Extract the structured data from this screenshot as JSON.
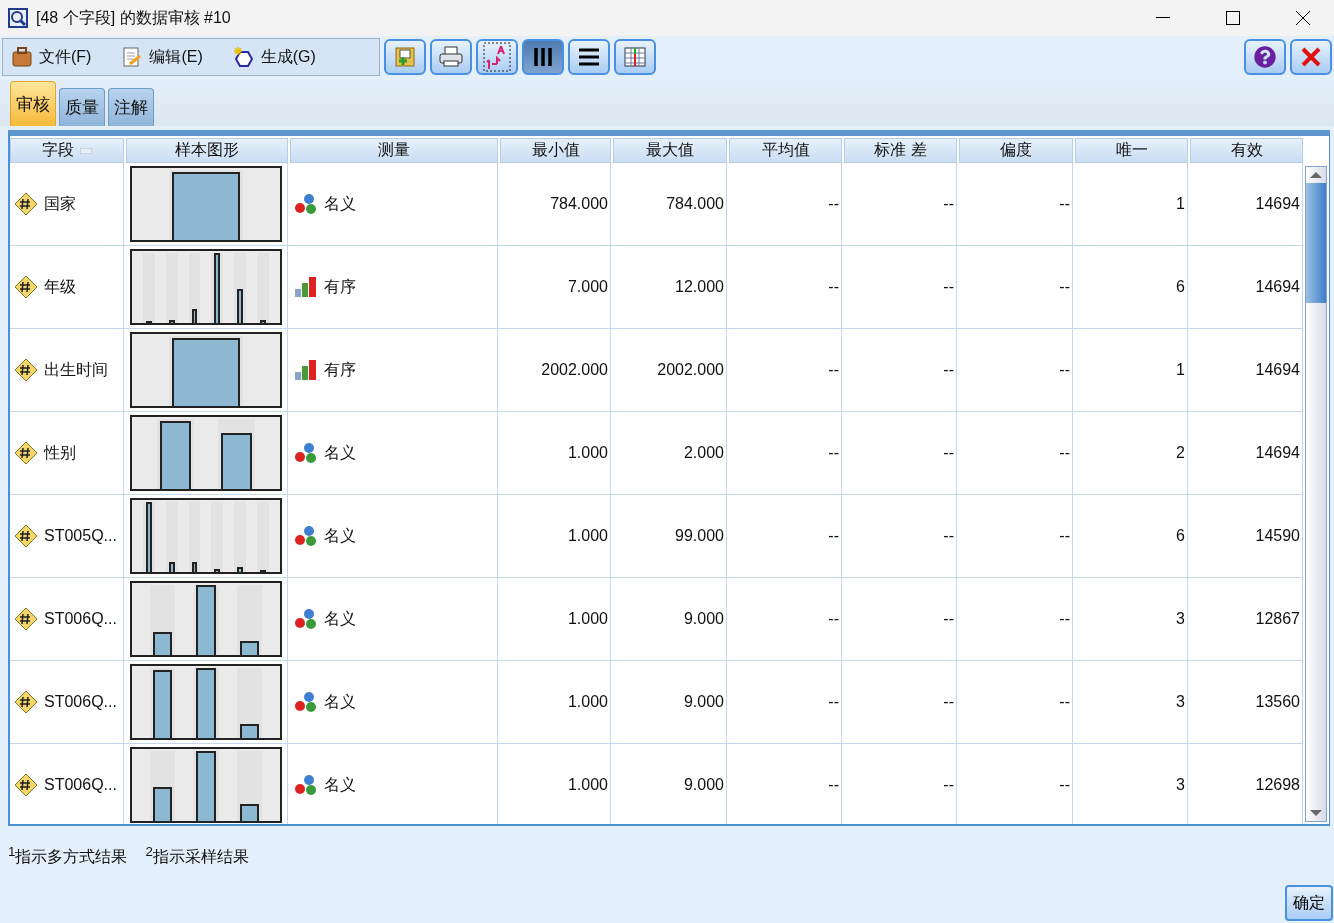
{
  "window": {
    "title": "[48 个字段] 的数据审核 #10"
  },
  "menu": [
    "文件(F)",
    "编辑(E)",
    "生成(G)"
  ],
  "toolbar": [
    {
      "kind": "add",
      "pressed": false
    },
    {
      "kind": "print",
      "pressed": false
    },
    {
      "kind": "sort",
      "pressed": false
    },
    {
      "kind": "columns",
      "pressed": true
    },
    {
      "kind": "rows",
      "pressed": false
    },
    {
      "kind": "table",
      "pressed": false
    }
  ],
  "tabs": [
    {
      "label": "审核",
      "selected": true
    },
    {
      "label": "质量",
      "selected": false
    },
    {
      "label": "注解",
      "selected": false
    }
  ],
  "table": {
    "columns": [
      "字段",
      "样本图形",
      "测量",
      "最小值",
      "最大值",
      "平均值",
      "标准 差",
      "偏度",
      "唯一",
      "有效"
    ],
    "rows": [
      {
        "field": "国家",
        "graph": [
          {
            "level": 0.97
          }
        ],
        "measure": {
          "kind": "nominal",
          "label": "名义"
        },
        "min": "784.000",
        "max": "784.000",
        "mean": "--",
        "sd": "--",
        "skew": "--",
        "unique": "1",
        "valid": "14694"
      },
      {
        "field": "年级",
        "graph": [
          {
            "level": 0.03
          },
          {
            "level": 0.04
          },
          {
            "level": 0.2
          },
          {
            "level": 1.0
          },
          {
            "level": 0.48
          },
          {
            "level": 0.04
          }
        ],
        "measure": {
          "kind": "ordinal",
          "label": "有序"
        },
        "min": "7.000",
        "max": "12.000",
        "mean": "--",
        "sd": "--",
        "skew": "--",
        "unique": "6",
        "valid": "14694"
      },
      {
        "field": "出生时间",
        "graph": [
          {
            "level": 0.97
          }
        ],
        "measure": {
          "kind": "ordinal",
          "label": "有序"
        },
        "min": "2002.000",
        "max": "2002.000",
        "mean": "--",
        "sd": "--",
        "skew": "--",
        "unique": "1",
        "valid": "14694"
      },
      {
        "field": "性别",
        "graph": [
          {
            "level": 0.97
          },
          {
            "level": 0.8
          }
        ],
        "measure": {
          "kind": "nominal",
          "label": "名义"
        },
        "min": "1.000",
        "max": "2.000",
        "mean": "--",
        "sd": "--",
        "skew": "--",
        "unique": "2",
        "valid": "14694"
      },
      {
        "field": "ST005Q...",
        "graph": [
          {
            "level": 1.0
          },
          {
            "level": 0.14
          },
          {
            "level": 0.14
          },
          {
            "level": 0.05
          },
          {
            "level": 0.07
          },
          {
            "level": 0.03
          }
        ],
        "measure": {
          "kind": "nominal",
          "label": "名义"
        },
        "min": "1.000",
        "max": "99.000",
        "mean": "--",
        "sd": "--",
        "skew": "--",
        "unique": "6",
        "valid": "14590"
      },
      {
        "field": "ST006Q...",
        "graph": [
          {
            "level": 0.33
          },
          {
            "level": 1.0
          },
          {
            "level": 0.2
          }
        ],
        "measure": {
          "kind": "nominal",
          "label": "名义"
        },
        "min": "1.000",
        "max": "9.000",
        "mean": "--",
        "sd": "--",
        "skew": "--",
        "unique": "3",
        "valid": "12867"
      },
      {
        "field": "ST006Q...",
        "graph": [
          {
            "level": 0.97
          },
          {
            "level": 1.0
          },
          {
            "level": 0.2
          }
        ],
        "measure": {
          "kind": "nominal",
          "label": "名义"
        },
        "min": "1.000",
        "max": "9.000",
        "mean": "--",
        "sd": "--",
        "skew": "--",
        "unique": "3",
        "valid": "13560"
      },
      {
        "field": "ST006Q...",
        "graph": [
          {
            "level": 0.48
          },
          {
            "level": 1.0
          },
          {
            "level": 0.25
          }
        ],
        "measure": {
          "kind": "nominal",
          "label": "名义"
        },
        "min": "1.000",
        "max": "9.000",
        "mean": "--",
        "sd": "--",
        "skew": "--",
        "unique": "3",
        "valid": "12698"
      }
    ]
  },
  "footnotes": [
    "$^{1}$指示多方式结果",
    "$^{2}$指示采样结果"
  ],
  "ok_button": "确定"
}
